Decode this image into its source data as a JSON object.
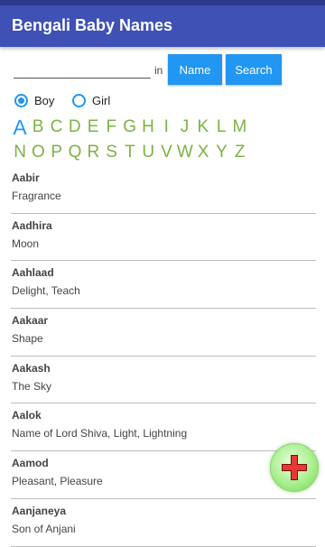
{
  "app": {
    "title": "Bengali Baby Names"
  },
  "search": {
    "placeholder": "",
    "in_label": "in",
    "name_button": "Name",
    "search_button": "Search"
  },
  "gender": {
    "options": [
      {
        "label": "Boy",
        "selected": true
      },
      {
        "label": "Girl",
        "selected": false
      }
    ]
  },
  "alphabet": {
    "row1": [
      "A",
      "B",
      "C",
      "D",
      "E",
      "F",
      "G",
      "H",
      "I",
      "J",
      "K",
      "L",
      "M"
    ],
    "row2": [
      "N",
      "O",
      "P",
      "Q",
      "R",
      "S",
      "T",
      "U",
      "V",
      "W",
      "X",
      "Y",
      "Z"
    ]
  },
  "names": [
    {
      "name": "Aabir",
      "meaning": "Fragrance"
    },
    {
      "name": "Aadhira",
      "meaning": "Moon"
    },
    {
      "name": "Aahlaad",
      "meaning": "Delight, Teach"
    },
    {
      "name": "Aakaar",
      "meaning": "Shape"
    },
    {
      "name": "Aakash",
      "meaning": "The Sky"
    },
    {
      "name": "Aalok",
      "meaning": "Name of Lord Shiva, Light, Lightning"
    },
    {
      "name": "Aamod",
      "meaning": "Pleasant, Pleasure"
    },
    {
      "name": "Aanjaneya",
      "meaning": "Son of Anjani"
    }
  ],
  "colors": {
    "app_bar": "#3f51b5",
    "button": "#2196f3",
    "letter": "#7cb342",
    "fab_plus": "#e53935"
  },
  "fab": {
    "icon": "plus-icon"
  }
}
